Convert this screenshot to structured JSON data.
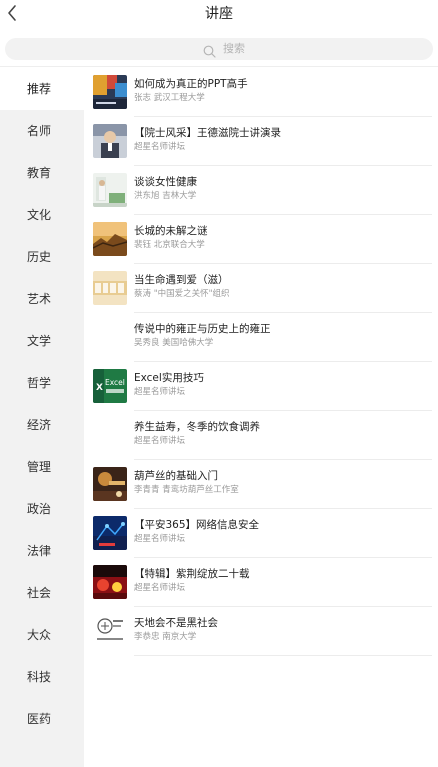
{
  "header": {
    "title": "讲座"
  },
  "search": {
    "placeholder": "搜索"
  },
  "sidebar": {
    "items": [
      {
        "label": "推荐",
        "active": true
      },
      {
        "label": "名师"
      },
      {
        "label": "教育"
      },
      {
        "label": "文化"
      },
      {
        "label": "历史"
      },
      {
        "label": "艺术"
      },
      {
        "label": "文学"
      },
      {
        "label": "哲学"
      },
      {
        "label": "经济"
      },
      {
        "label": "管理"
      },
      {
        "label": "政治"
      },
      {
        "label": "法律"
      },
      {
        "label": "社会"
      },
      {
        "label": "大众"
      },
      {
        "label": "科技"
      },
      {
        "label": "医药"
      }
    ]
  },
  "lectures": [
    {
      "title": "如何成为真正的PPT高手",
      "subtitle": "张志 武汉工程大学",
      "thumb": "ppt-thumbnail"
    },
    {
      "title": "【院士风采】王德滋院士讲演录",
      "subtitle": "超星名师讲坛",
      "thumb": "academician-portrait-thumbnail"
    },
    {
      "title": "谈谈女性健康",
      "subtitle": "洪东旭 吉林大学",
      "thumb": "health-thumbnail"
    },
    {
      "title": "长城的未解之谜",
      "subtitle": "裴钰 北京联合大学",
      "thumb": "great-wall-thumbnail"
    },
    {
      "title": "当生命遇到爱（滋）",
      "subtitle": "蔡涛 \"中国爱之关怀\"组织",
      "thumb": "aids-thumbnail"
    },
    {
      "title": "传说中的雍正与历史上的雍正",
      "subtitle": "吴秀良 美国哈佛大学",
      "thumb": ""
    },
    {
      "title": "Excel实用技巧",
      "subtitle": "超星名师讲坛",
      "thumb": "excel-thumbnail",
      "thumb_text": "Excel"
    },
    {
      "title": "养生益寿，冬季的饮食调养",
      "subtitle": "超星名师讲坛",
      "thumb": ""
    },
    {
      "title": "葫芦丝的基础入门",
      "subtitle": "李青青 青鸾坊葫芦丝工作室",
      "thumb": "hulusi-thumbnail"
    },
    {
      "title": "【平安365】网络信息安全",
      "subtitle": "超星名师讲坛",
      "thumb": "network-security-thumbnail"
    },
    {
      "title": "【特辑】紫荆绽放二十载",
      "subtitle": "超星名师讲坛",
      "thumb": "bauhinia-thumbnail"
    },
    {
      "title": "天地会不是黑社会",
      "subtitle": "李恭忠 南京大学",
      "thumb": "tiandihui-thumbnail"
    }
  ],
  "colors": {
    "sidebar_bg": "#f2f2f2",
    "active_bg": "#ffffff",
    "subtitle": "#9a9a9a",
    "search_bg": "#f2f2f2"
  }
}
